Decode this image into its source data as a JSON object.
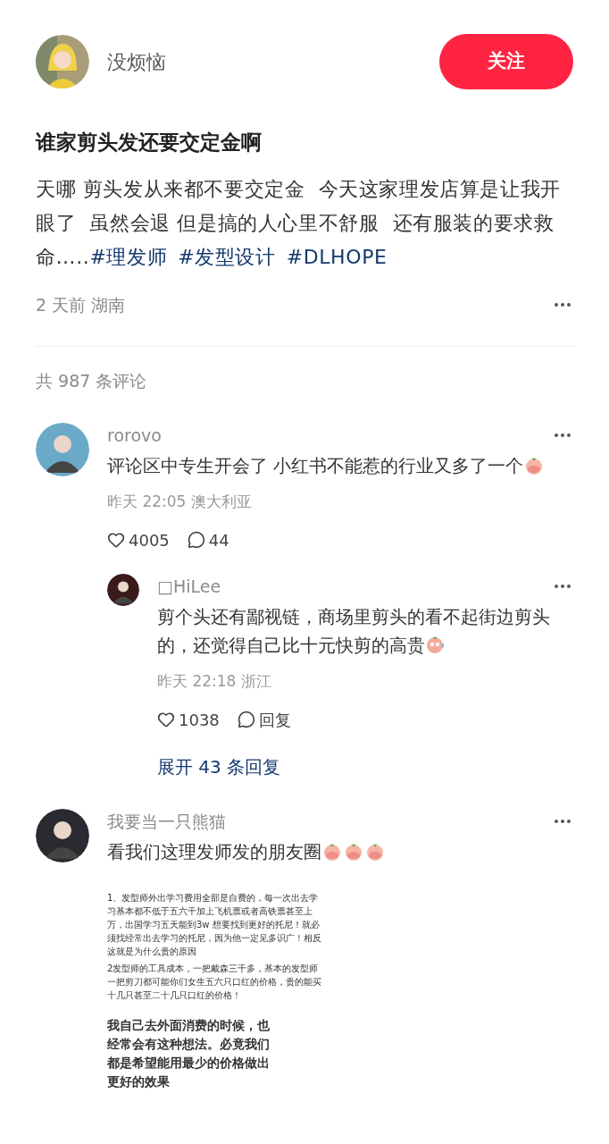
{
  "author": {
    "name": "没烦恼",
    "follow_button": "关注"
  },
  "post": {
    "title": "谁家剪头发还要交定金啊",
    "body": "天哪 剪头发从来都不要交定金  今天这家理发店算是让我开眼了  虽然会退 但是搞的人心里不舒服  还有服装的要求救命…..",
    "tags": [
      "#理发师",
      "#发型设计",
      "#DLHOPE"
    ],
    "meta": "2 天前 湖南"
  },
  "comment_count": "共 987 条评论",
  "comments": [
    {
      "user": "rorovo",
      "text": "评论区中专生开会了 小红书不能惹的行业又多了一个",
      "stickers": [
        {
          "kind": "peach"
        }
      ],
      "meta": "昨天 22:05 澳大利亚",
      "likes": "4005",
      "reply_label": "44",
      "replies": [
        {
          "user": "□HiLee",
          "text": "剪个头还有鄙视链，商场里剪头的看不起街边剪头的，还觉得自己比十元快剪的高贵",
          "stickers": [
            {
              "kind": "sweat"
            }
          ],
          "meta": "昨天 22:18 浙江",
          "likes": "1038",
          "reply_label": "回复"
        }
      ],
      "expand": "展开 43 条回复"
    },
    {
      "user": "我要当一只熊猫",
      "text": "看我们这理发师发的朋友圈",
      "stickers": [
        {
          "kind": "peach"
        },
        {
          "kind": "peach"
        },
        {
          "kind": "peach"
        }
      ],
      "image_doc": {
        "small": [
          "1、发型师外出学习费用全部是自费的，每一次出去学习基本都不低于五六千加上飞机票或者高铁票甚至上万，出国学习五天能到3w  想要找到更好的托尼！就必须找经常出去学习的托尼，因为他一定见多识广！相反这就是为什么贵的原因",
          "2发型师的工具成本，一把戴森三千多，基本的发型师一把剪刀都可能你们女生五六只口红的价格，贵的能买十几只甚至二十几只口红的价格！"
        ],
        "large": "我自己去外面消费的时候，也经常会有这种想法。必竟我们都是希望能用最少的价格做出更好的效果"
      }
    }
  ]
}
